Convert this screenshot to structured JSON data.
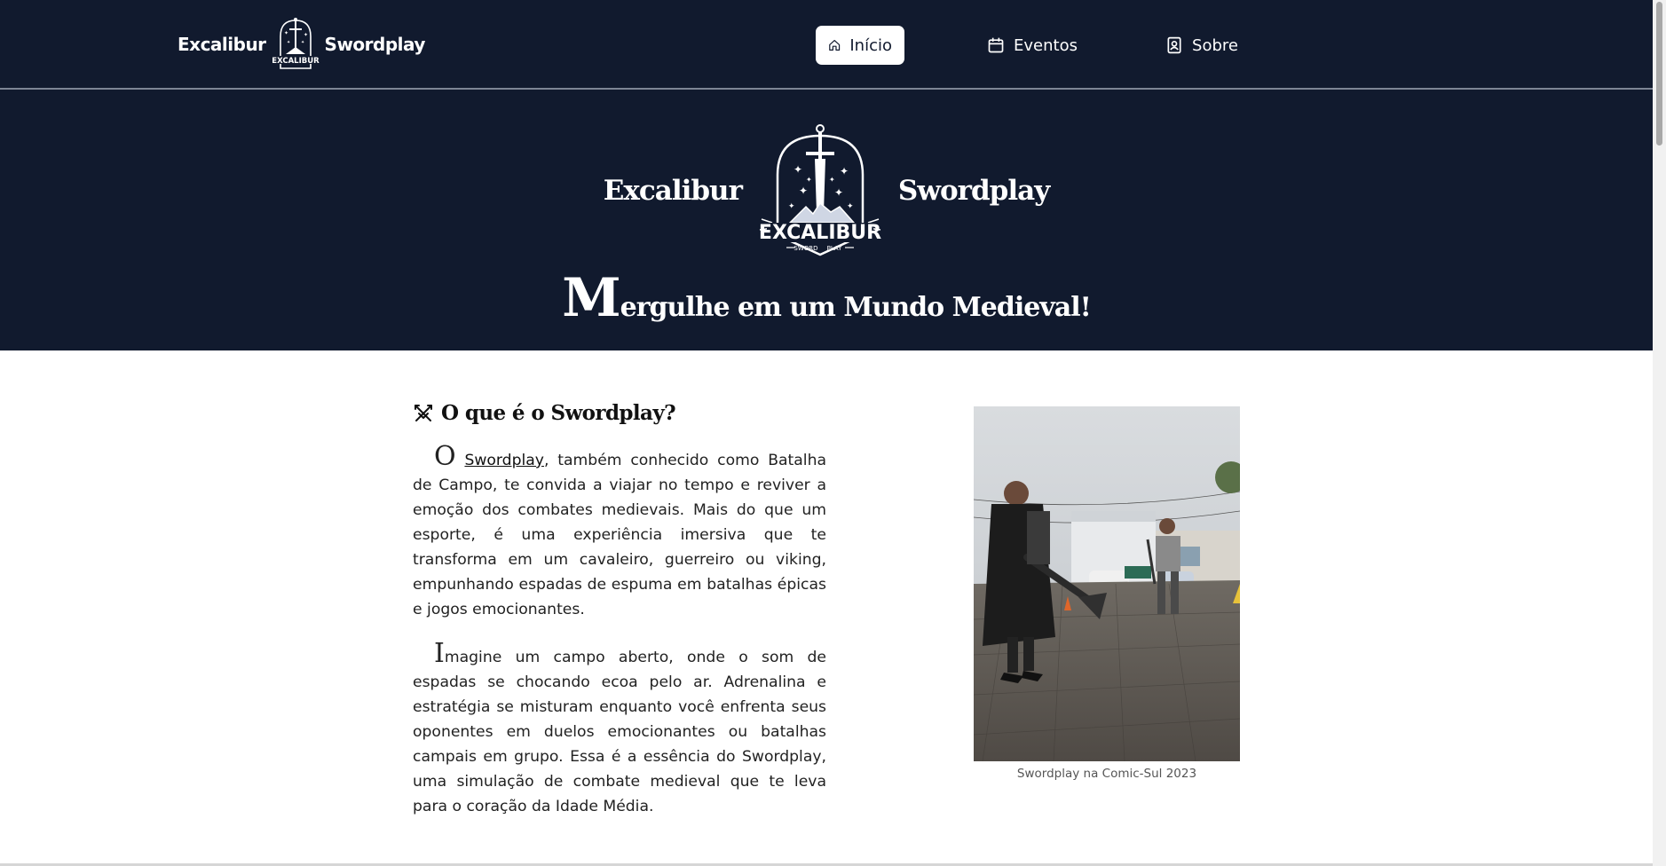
{
  "nav": {
    "brand_left": "Excalibur",
    "brand_right": "Swordplay",
    "links": [
      {
        "label": "Início",
        "icon": "home-icon",
        "active": true
      },
      {
        "label": "Eventos",
        "icon": "calendar-icon",
        "active": false
      },
      {
        "label": "Sobre",
        "icon": "contact-icon",
        "active": false
      }
    ]
  },
  "hero": {
    "brand_left": "Excalibur",
    "brand_right": "Swordplay",
    "logo_text": "EXCALIBUR",
    "logo_sub_left": "SWORD",
    "logo_sub_right": "PLAY",
    "title_initial": "M",
    "title_rest": "ergulhe em um Mundo Medieval!"
  },
  "section": {
    "icon": "crossed-swords-icon",
    "title": "O que é o Swordplay?",
    "p1_initial": "O",
    "p1_link": "Swordplay",
    "p1_rest": ", também conhecido como Batalha de Campo, te convida a viajar no tempo e reviver a emoção dos combates medievais. Mais do que um esporte, é uma experiência imersiva que te transforma em um cavaleiro, guerreiro ou viking, empunhando espadas de espuma em batalhas épicas e jogos emocionantes.",
    "p2_initial": "I",
    "p2_rest": "magine um campo aberto, onde o som de espadas se chocando ecoa pelo ar. Adrenalina e estratégia se misturam enquanto você enfrenta seus oponentes em duelos emocionantes ou batalhas campais em grupo. Essa é a essência do Swordplay, uma simulação de combate medieval que te leva para o coração da Idade Média."
  },
  "figure": {
    "caption": "Swordplay na Comic-Sul 2023"
  },
  "colors": {
    "navy": "#111a2e",
    "white": "#ffffff",
    "text": "#222222"
  }
}
